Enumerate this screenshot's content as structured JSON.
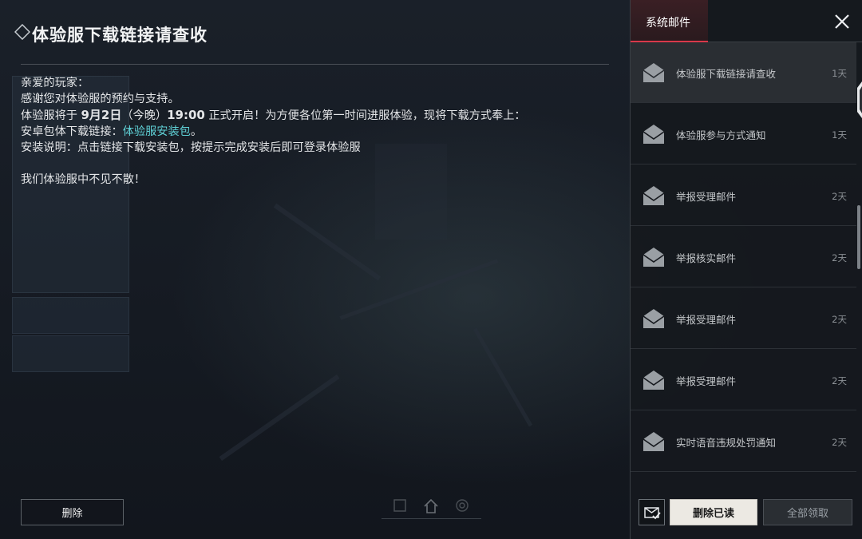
{
  "mail": {
    "title": "体验服下载链接请查收",
    "greeting": "亲爱的玩家：",
    "line_thanks": "感谢您对体验服的预约与支持。",
    "line_open_pre": "体验服将于 ",
    "line_open_date": "9月2日",
    "line_open_paren": "（今晚）",
    "line_open_time": "19:00",
    "line_open_post": " 正式开启！为方便各位第一时间进服体验，现将下载方式奉上：",
    "line_link_pre": "安卓包体下载链接：",
    "line_link_text": "体验服安装包",
    "line_link_post": "。",
    "line_install": "安装说明：点击链接下载安装包，按提示完成安装后即可登录体验服",
    "line_farewell": "我们体验服中不见不散！",
    "delete_label": "删除"
  },
  "side_panel": {
    "tab_label": "系统邮件",
    "items": [
      {
        "subject": "体验服下载链接请查收",
        "age": "1天",
        "selected": true
      },
      {
        "subject": "体验服参与方式通知",
        "age": "1天"
      },
      {
        "subject": "举报受理邮件",
        "age": "2天"
      },
      {
        "subject": "举报核实邮件",
        "age": "2天"
      },
      {
        "subject": "举报受理邮件",
        "age": "2天"
      },
      {
        "subject": "举报受理邮件",
        "age": "2天"
      },
      {
        "subject": "实时语音违规处罚通知",
        "age": "2天"
      }
    ],
    "delete_read_label": "删除已读",
    "claim_all_label": "全部领取"
  },
  "icons": {
    "close": "close-icon",
    "envelope": "envelope-icon",
    "mark_read": "mark-all-read-icon",
    "title_marker": "diamond-icon"
  },
  "colors": {
    "accent_red": "#d8384a",
    "link_cyan": "#5fd1d6",
    "panel_bg": "#16191e"
  }
}
